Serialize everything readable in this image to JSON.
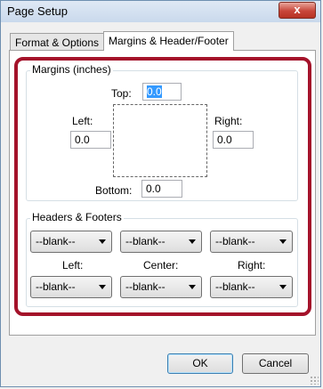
{
  "window": {
    "title": "Page Setup",
    "close_glyph": "x"
  },
  "tabs": [
    {
      "label": "Format & Options",
      "active": false
    },
    {
      "label": "Margins & Header/Footer",
      "active": true
    }
  ],
  "margins": {
    "group_label": "Margins (inches)",
    "top": {
      "label": "Top:",
      "value": "0.0"
    },
    "left": {
      "label": "Left:",
      "value": "0.0"
    },
    "right": {
      "label": "Right:",
      "value": "0.0"
    },
    "bottom": {
      "label": "Bottom:",
      "value": "0.0"
    }
  },
  "headers_footers": {
    "group_label": "Headers & Footers",
    "header_left": "--blank--",
    "header_center": "--blank--",
    "header_right": "--blank--",
    "left_label": "Left:",
    "center_label": "Center:",
    "right_label": "Right:",
    "footer_left": "--blank--",
    "footer_center": "--blank--",
    "footer_right": "--blank--"
  },
  "buttons": {
    "ok": "OK",
    "cancel": "Cancel"
  },
  "colors": {
    "highlight": "#a4122a",
    "selection": "#3399ff",
    "close_button": "#c8463a"
  }
}
